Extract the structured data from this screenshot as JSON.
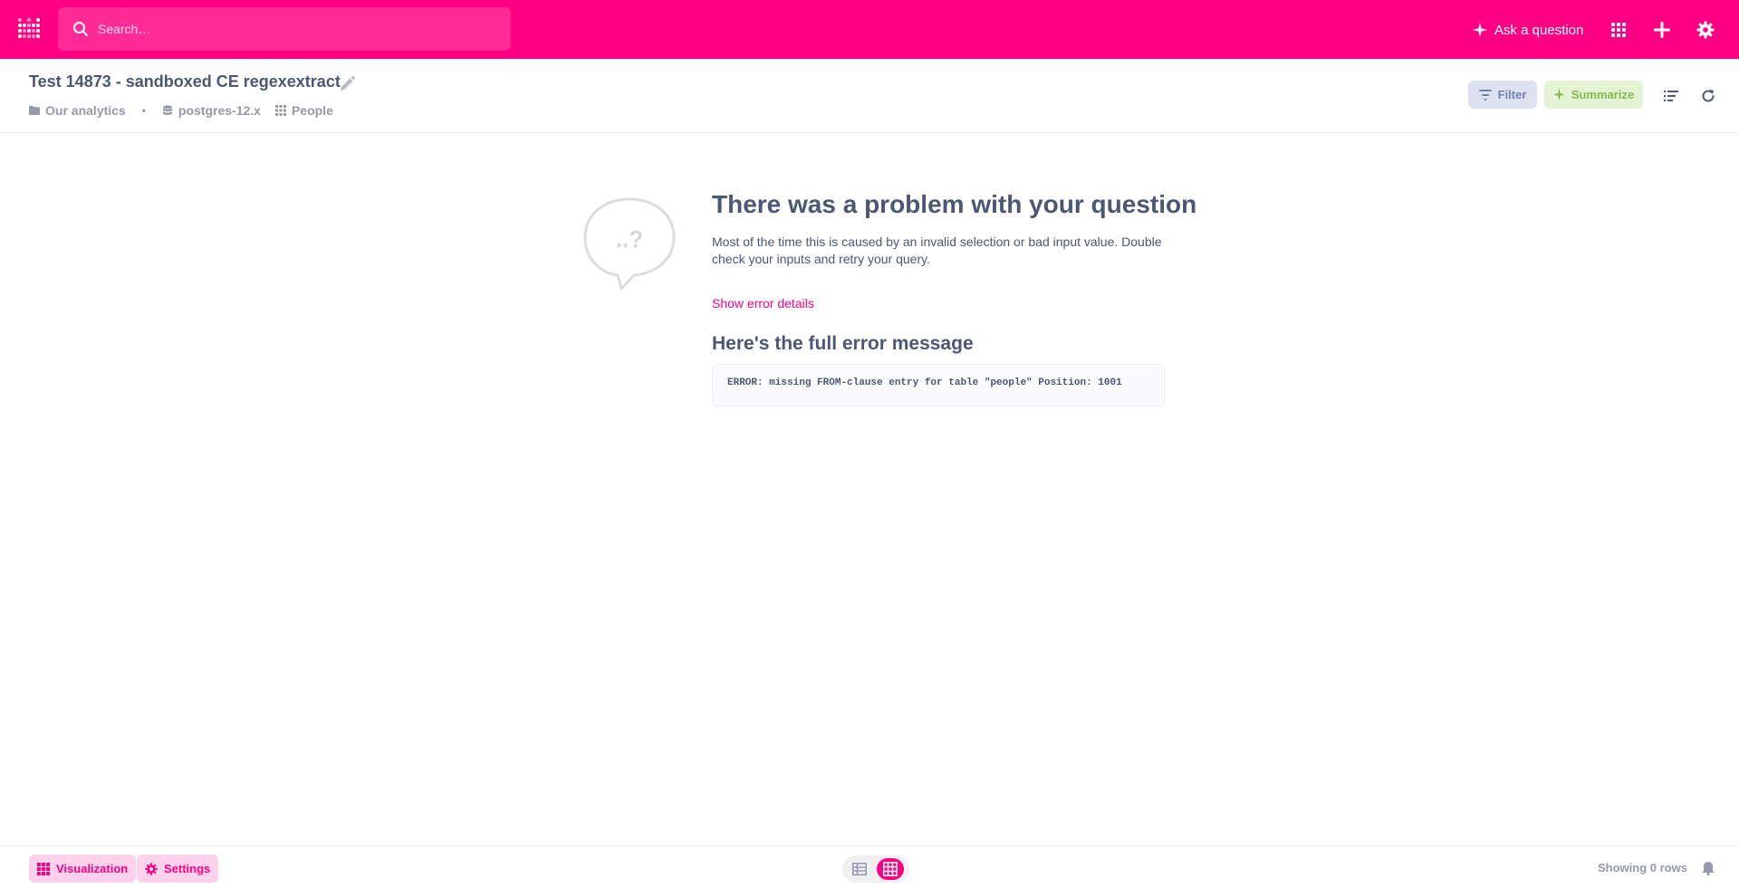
{
  "colors": {
    "brand": "#ff0083",
    "text": "#4c5773",
    "muted": "#949aab",
    "filter_bg": "#dde2f0",
    "filter_text": "#7281b4",
    "summarize_bg": "#e3f3d4",
    "summarize_text": "#84bb4c"
  },
  "topnav": {
    "logo_icon": "metabase-logo-icon",
    "search": {
      "placeholder": "Search…",
      "value": "",
      "icon": "search-icon"
    },
    "ask_question_label": "Ask a question",
    "icons": [
      "sparkle-icon",
      "grid-apps-icon",
      "plus-icon",
      "gear-icon"
    ]
  },
  "header": {
    "title": "Test 14873 - sandboxed CE regexextract",
    "breadcrumbs": {
      "collection": "Our analytics",
      "database": "postgres-12.x",
      "table": "People"
    },
    "filter_label": "Filter",
    "summarize_label": "Summarize"
  },
  "error": {
    "title": "There was a problem with your question",
    "description": "Most of the time this is caused by an invalid selection or bad input value. Double check your inputs and retry your query.",
    "details_link": "Show error details",
    "full_message_heading": "Here's the full error message",
    "message": "ERROR: missing FROM-clause entry for table \"people\" Position: 1001",
    "bubble_text": "..?"
  },
  "footer": {
    "visualization_label": "Visualization",
    "settings_label": "Settings",
    "view_toggle_active": "visualization",
    "row_count": "Showing 0 rows"
  }
}
